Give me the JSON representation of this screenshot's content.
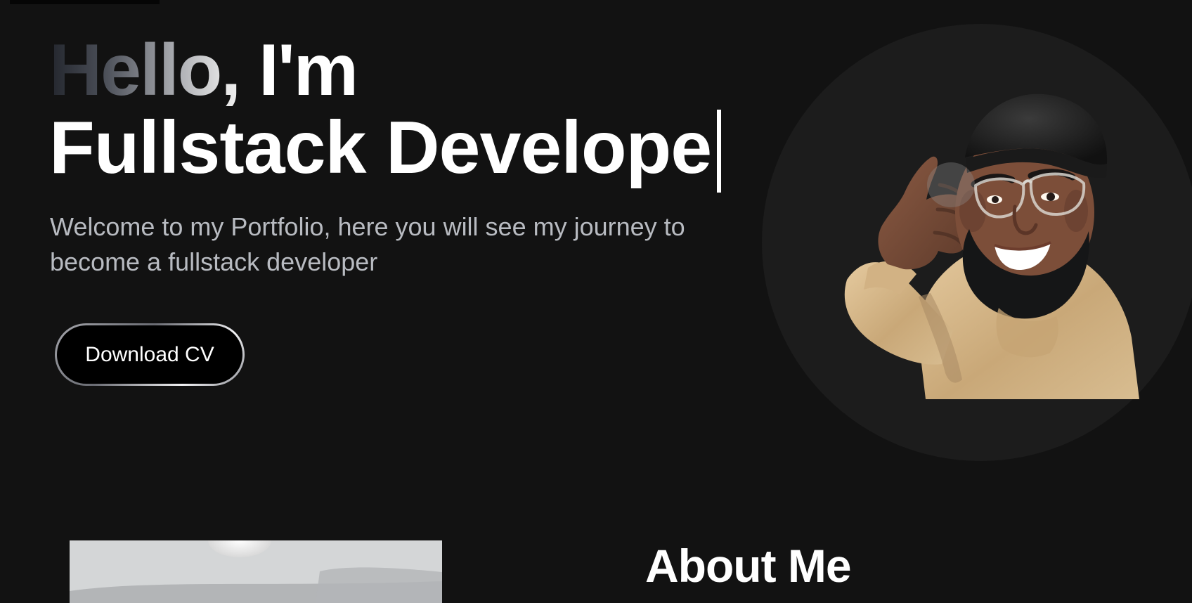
{
  "hero": {
    "greeting": "Hello, I'm",
    "role": "Fullstack Develope",
    "welcome": "Welcome to my Portfolio, here you will see my journey to become a fullstack developer",
    "download_label": "Download CV"
  },
  "about": {
    "title": "About Me"
  },
  "colors": {
    "background": "#121212",
    "primary_text": "#ffffff",
    "secondary_text": "#b8bbc1",
    "avatar_circle": "#1c1c1c",
    "button": "#000000"
  },
  "icons": {
    "avatar": "memoji-avatar-waving",
    "photo": "profile-photo-preview",
    "cursor": "typing-cursor"
  }
}
